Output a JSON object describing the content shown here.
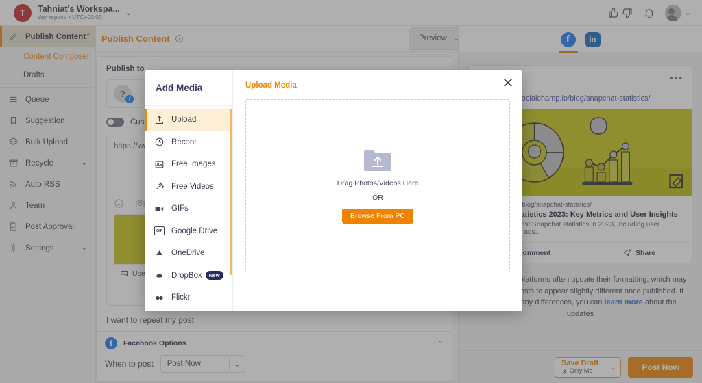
{
  "topbar": {
    "workspace_initial": "T",
    "workspace_name": "Tahniat's Workspa...",
    "workspace_sub": "Workspace • UTC+00:00",
    "chevron": "⌄",
    "icons": [
      "thumbs-up-down-icon",
      "bell-icon",
      "avatar"
    ]
  },
  "sidebar": {
    "publish_content": "Publish Content",
    "publish_caret": "⌃",
    "sub_items": [
      {
        "label": "Content Composer",
        "selected": true
      },
      {
        "label": "Drafts",
        "selected": false
      }
    ],
    "items": [
      {
        "label": "Queue",
        "icon": "list-icon",
        "caret": ""
      },
      {
        "label": "Suggestion",
        "icon": "bookmark-icon",
        "caret": ""
      },
      {
        "label": "Bulk Upload",
        "icon": "layers-icon",
        "caret": ""
      },
      {
        "label": "Recycle",
        "icon": "archive-icon",
        "caret": "⌄"
      },
      {
        "label": "Auto RSS",
        "icon": "rss-icon",
        "caret": ""
      },
      {
        "label": "Team",
        "icon": "user-icon",
        "caret": ""
      },
      {
        "label": "Post Approval",
        "icon": "file-check-icon",
        "caret": ""
      },
      {
        "label": "Settings",
        "icon": "gear-icon",
        "caret": "⌄"
      }
    ]
  },
  "main": {
    "page_title": "Publish Content",
    "preview_label": "Preview",
    "preview_arrow": "→|",
    "publish_to_label": "Publish to",
    "account_avatar": "?",
    "account_badge": "f",
    "custom_label": "Custom",
    "url_text": "https://www.",
    "use_ai_label": "Use AI",
    "repeat_text": "I want to repeat my post",
    "facebook_options_title": "Facebook Options",
    "fb_options_caret": "⌃",
    "when_to_post_label": "When to post",
    "when_to_post_value": "Post Now",
    "when_to_post_chevron": "⌄"
  },
  "preview_panel": {
    "tabs": [
      {
        "name": "facebook",
        "glyph": "f",
        "active": true
      },
      {
        "name": "linkedin",
        "glyph": "in",
        "active": false
      }
    ],
    "card": {
      "dots": "•••",
      "url": "https://www.socialchamp.io/blog/snapchat-statistics/",
      "domain": "socialchamp.io/blog/snapchat-statistics/",
      "title": "Snapchat Statistics 2023: Key Metrics and User Insights",
      "description": "Explore the latest Snapchat statistics in 2023, including user demographics, ads...",
      "actions": [
        {
          "label": "Comment",
          "icon": "comment-icon"
        },
        {
          "label": "Share",
          "icon": "share-icon"
        }
      ]
    },
    "note_line1": "Social media platforms often update their formatting, which may cause your",
    "note_line2": "posts to appear slightly different once published.",
    "note_line3_before": "If you notice any differences, you can ",
    "note_link": "learn more",
    "note_line3_after": " about the updates",
    "footer": {
      "save_draft_label": "Save Draft",
      "save_draft_sub": "Only Me",
      "save_draft_chevron": "⌄",
      "post_now_label": "Post Now"
    }
  },
  "modal": {
    "title": "Add Media",
    "close_label": "✕",
    "sidebar_items": [
      {
        "label": "Upload",
        "icon": "upload-icon",
        "selected": true,
        "badge": ""
      },
      {
        "label": "Recent",
        "icon": "clock-icon",
        "selected": false,
        "badge": ""
      },
      {
        "label": "Free Images",
        "icon": "image-icon",
        "selected": false,
        "badge": ""
      },
      {
        "label": "Free Videos",
        "icon": "magic-wand-icon",
        "selected": false,
        "badge": ""
      },
      {
        "label": "GIFs",
        "icon": "video-camera-icon",
        "selected": false,
        "badge": ""
      },
      {
        "label": "Google Drive",
        "icon": "gif-box-icon",
        "selected": false,
        "badge": ""
      },
      {
        "label": "OneDrive",
        "icon": "onedrive-icon",
        "selected": false,
        "badge": ""
      },
      {
        "label": "DropBox",
        "icon": "dropbox-icon",
        "selected": false,
        "badge": "New"
      },
      {
        "label": "Flickr",
        "icon": "flickr-icon",
        "selected": false,
        "badge": ""
      }
    ],
    "panel_title": "Upload Media",
    "drop_text": "Drag Photos/Videos Here",
    "or_text": "OR",
    "browse_button": "Browse From PC"
  },
  "colors": {
    "accent_orange": "#ef8200",
    "facebook_blue": "#1877f2",
    "linkedin_blue": "#0a66c2",
    "thumb_yellow": "#c3c310",
    "badge_navy": "#2a2a62"
  }
}
